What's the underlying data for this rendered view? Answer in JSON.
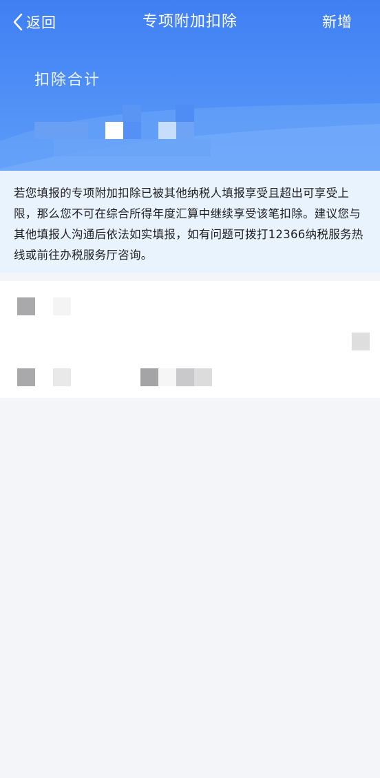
{
  "nav": {
    "back_label": "返回",
    "title": "专项附加扣除",
    "add_label": "新增"
  },
  "summary": {
    "label": "扣除合计"
  },
  "notice": {
    "text": "若您填报的专项附加扣除已被其他纳税人填报享受且超出可享受上限，那么您不可在综合所得年度汇算中继续享受该笔扣除。建议您与其他填报人沟通后依法如实填报，如有问题可拨打12366纳税服务热线或前往办税服务厅咨询。"
  },
  "colors": {
    "header_blue": "#3f7ff3",
    "notice_bg": "#e9f3fe",
    "page_bg": "#f4f5f9"
  },
  "icons": {
    "back": "chevron-left-icon"
  }
}
